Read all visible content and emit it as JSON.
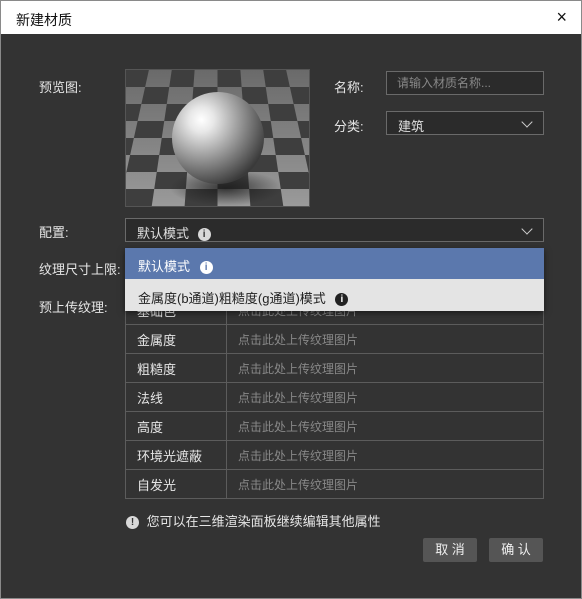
{
  "window": {
    "title": "新建材质",
    "close_icon": "×"
  },
  "form": {
    "preview_label": "预览图:",
    "name_label": "名称:",
    "name_placeholder": "请输入材质名称...",
    "category_label": "分类:",
    "category_value": "建筑",
    "config_label": "配置:",
    "config_value": "默认模式",
    "texture_limit_label": "纹理尺寸上限:",
    "preupload_label": "预上传纹理:"
  },
  "dropdown": {
    "options": [
      {
        "label": "默认模式",
        "selected": true
      },
      {
        "label": "金属度(b通道)粗糙度(g通道)模式",
        "selected": false
      }
    ]
  },
  "textures": {
    "upload_text": "点击此处上传纹理图片",
    "rows": [
      {
        "name": "基础色"
      },
      {
        "name": "金属度"
      },
      {
        "name": "粗糙度"
      },
      {
        "name": "法线"
      },
      {
        "name": "高度"
      },
      {
        "name": "环境光遮蔽"
      },
      {
        "name": "自发光"
      }
    ]
  },
  "hint": "您可以在三维渲染面板继续编辑其他属性",
  "buttons": {
    "cancel": "取 消",
    "confirm": "确 认"
  },
  "colors": {
    "background": "#333333",
    "accent": "#5b78ad",
    "button": "#555555"
  }
}
